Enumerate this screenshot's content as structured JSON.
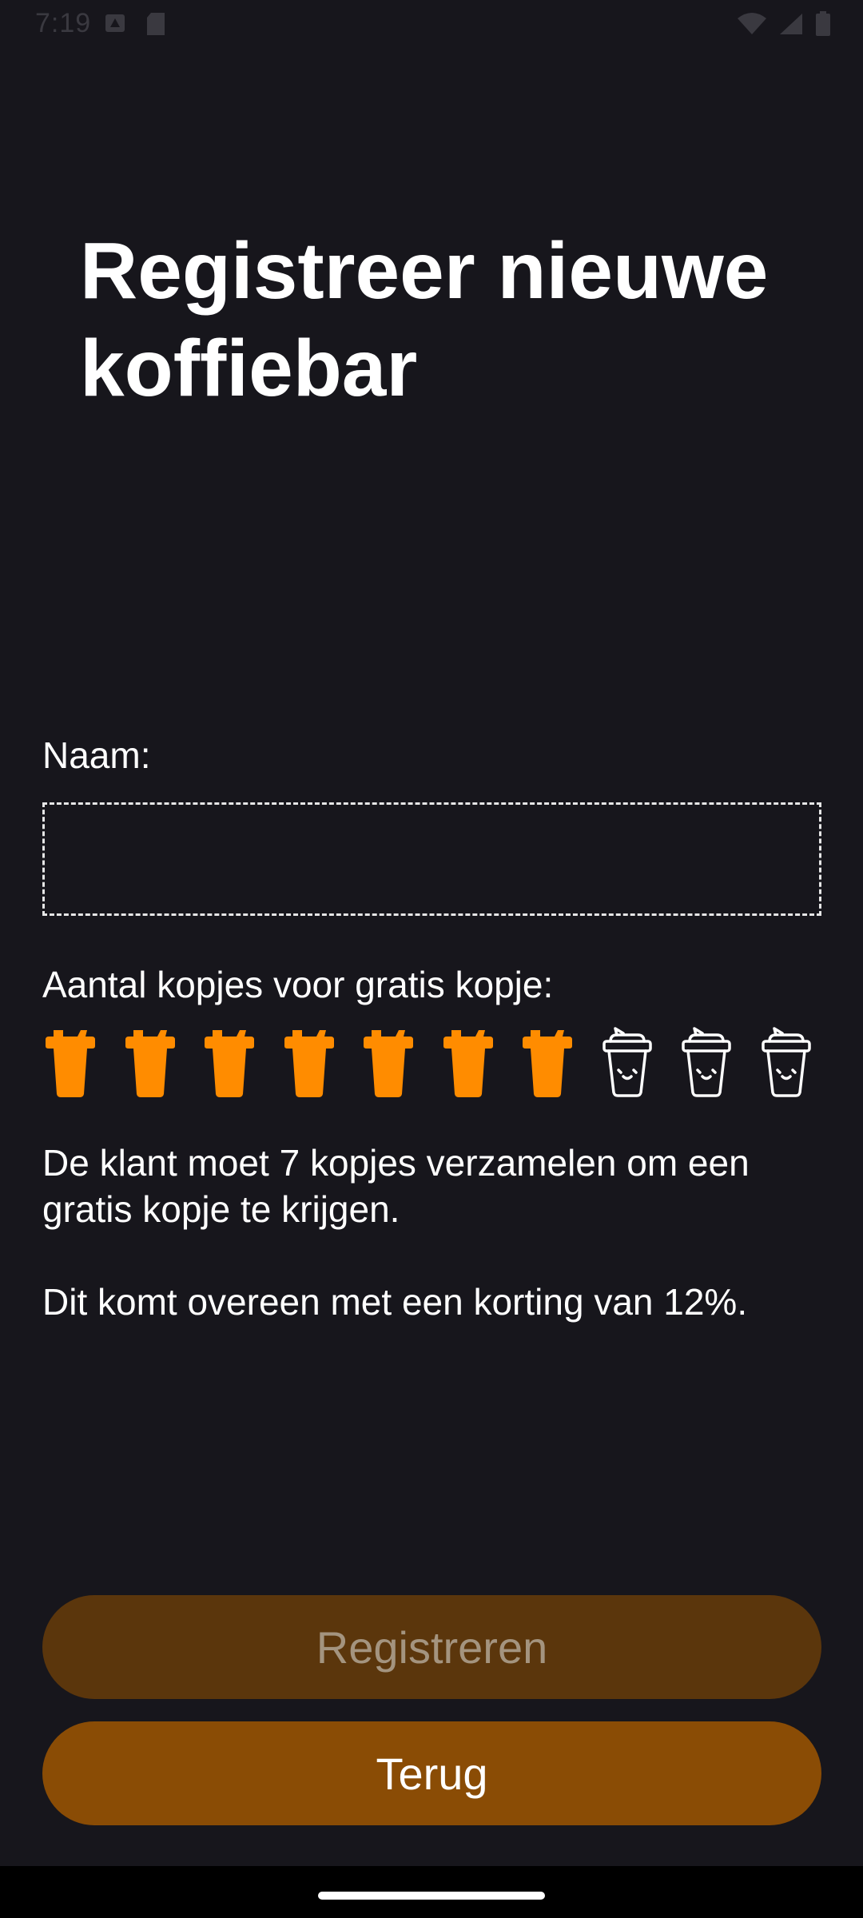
{
  "status_bar": {
    "time": "7:19",
    "left_icons": [
      "notification-icon",
      "sd-card-icon"
    ],
    "right_icons": [
      "wifi-icon",
      "signal-icon",
      "battery-icon"
    ]
  },
  "page": {
    "title": "Registreer nieuwe koffiebar"
  },
  "form": {
    "name_label": "Naam:",
    "name_value": "",
    "name_placeholder": "",
    "cups_label": "Aantal kopjes voor gratis kopje:",
    "cups": {
      "selected": 7,
      "total": 10,
      "filled_icon": "coffee-cup-filled-icon",
      "empty_icon": "coffee-cup-outline-icon",
      "filled_color": "#ff8c00",
      "empty_color": "#ffffff"
    },
    "info_cups": "De klant moet 7 kopjes verzamelen om een gratis kopje te krijgen.",
    "info_discount": "Dit komt overeen met een korting van 12%."
  },
  "buttons": {
    "register_label": "Registreren",
    "back_label": "Terug"
  },
  "colors": {
    "background": "#17161c",
    "register_button": "#5b360c",
    "back_button": "#8a4c05",
    "accent": "#ff8c00"
  }
}
